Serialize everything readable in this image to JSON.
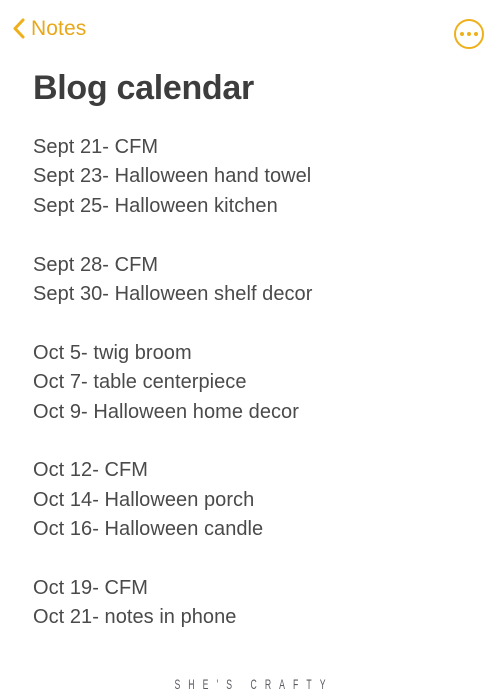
{
  "navbar": {
    "back_label": "Notes",
    "back_icon": "chevron-left-icon",
    "more_icon": "more-options-icon",
    "accent_color": "#eeb01c"
  },
  "note": {
    "title": "Blog calendar",
    "title_color": "#3d3d3d",
    "body_color": "#4a4a4a",
    "lines": [
      "Sept 21- CFM",
      "Sept 23- Halloween hand towel",
      "Sept 25- Halloween kitchen",
      "",
      "Sept 28- CFM",
      "Sept 30- Halloween shelf decor",
      "",
      "Oct 5- twig broom",
      "Oct 7- table centerpiece",
      "Oct 9- Halloween home decor",
      "",
      "Oct 12- CFM",
      "Oct 14- Halloween porch",
      "Oct 16- Halloween candle",
      "",
      "Oct 19- CFM",
      "Oct 21- notes in phone"
    ]
  },
  "watermark": {
    "text": "SHE'S CRAFTY"
  }
}
